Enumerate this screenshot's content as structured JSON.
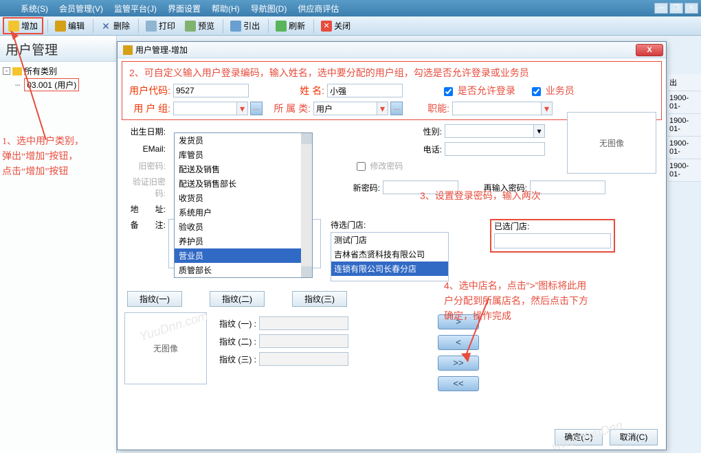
{
  "menubar": {
    "items": [
      {
        "label": "系统(S)"
      },
      {
        "label": "会员管理(V)"
      },
      {
        "label": "监管平台(J)"
      },
      {
        "label": "界面设置"
      },
      {
        "label": "帮助(H)"
      },
      {
        "label": "导航图(D)"
      },
      {
        "label": "供应商评估"
      }
    ]
  },
  "toolbar": {
    "add": "增加",
    "edit": "编辑",
    "delete": "删除",
    "print": "打印",
    "preview": "预览",
    "export": "引出",
    "refresh": "刷新",
    "close": "关闭"
  },
  "sidebar": {
    "title": "用户管理",
    "tree": {
      "root": "所有类别",
      "child": "03.001 (用户)"
    }
  },
  "annotations": {
    "a1": "1、选中用户类别，\n弹出“增加”按钮，\n点击“增加”按钮",
    "a2": "2、可自定义输入用户登录编码，输入姓名，选中要分配的用户组，勾选是否允许登录或业务员",
    "a3": "3、设置登录密码，输入两次",
    "a4": "4、选中店名，点击“>”图标将此用户分配到所属店名，然后点击下方确定，操作完成"
  },
  "modal": {
    "title": "用户管理-增加",
    "labels": {
      "code": "用户代码:",
      "name": "姓 名:",
      "allow_login": "是否允许登录",
      "salesman": "业务员",
      "group": "用 户 组:",
      "cat": "所 属 类:",
      "job": "职能:",
      "birthday": "出生日期:",
      "sex": "性别:",
      "email": "EMail:",
      "phone": "电话:",
      "oldpwd": "旧密码:",
      "modify": "修改密码",
      "verify": "验证旧密码:",
      "newpwd": "新密码:",
      "reinput": "再输入密码:",
      "addr": "地　　址:",
      "remark": "备　　注:",
      "pending": "待选门店:",
      "selected_store": "已选门店:",
      "noimg": "无图像"
    },
    "values": {
      "code": "9527",
      "name": "小强",
      "cat": "用户",
      "allow_login": true,
      "salesman": true
    },
    "group_options": [
      "发货员",
      "库管员",
      "配送及销售",
      "配送及销售部长",
      "收货员",
      "系统用户",
      "验收员",
      "养护员",
      "营业员",
      "质管部长"
    ],
    "group_selected_index": 8,
    "pending_stores": [
      "测试门店",
      "吉林省杰贤科技有限公司",
      "连锁有限公司长春分店"
    ],
    "pending_selected_index": 2,
    "fingerprint": {
      "btn1": "指纹(一)",
      "btn2": "指纹(二)",
      "btn3": "指纹(三)",
      "row1": "指纹 (一) :",
      "row2": "指纹 (二) :",
      "row3": "指纹 (三) :"
    },
    "move": {
      "r": ">",
      "l": "<",
      "rr": ">>",
      "ll": "<<"
    },
    "buttons": {
      "ok": "确定(O)",
      "cancel": "取消(C)"
    }
  },
  "bg_dates": [
    "出",
    "1900-01-",
    "1900-01-",
    "1900-01-",
    "1900-01-"
  ]
}
